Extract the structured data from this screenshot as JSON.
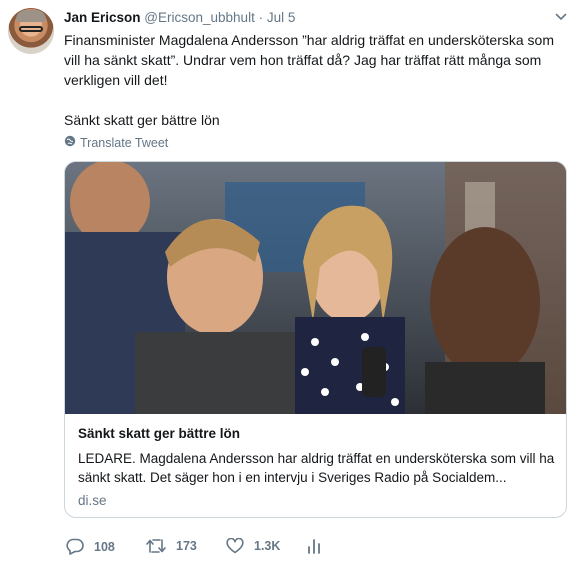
{
  "tweet": {
    "author_name": "Jan Ericson",
    "author_handle": "@Ericson_ubbhult",
    "separator": "·",
    "date": "Jul 5",
    "text_line1": "Finansminister Magdalena Andersson ”har aldrig träffat en undersköterska som vill ha sänkt skatt”.  Undrar vem hon träffat då? Jag har träffat rätt många som verkligen vill det!",
    "text_line2": "Sänkt skatt ger bättre lön",
    "translate_label": "Translate Tweet"
  },
  "card": {
    "title": "Sänkt skatt ger bättre lön",
    "description": "LEDARE. Magdalena Andersson har aldrig träffat en undersköterska som vill ha sänkt skatt. Det säger hon i en intervju i Sveriges Radio på Socialdem...",
    "domain": "di.se"
  },
  "actions": {
    "reply_count": "108",
    "retweet_count": "173",
    "like_count": "1.3K"
  },
  "icons": {
    "caret": "chevron-down-icon",
    "translate": "globe-icon",
    "reply": "reply-icon",
    "retweet": "retweet-icon",
    "like": "heart-icon",
    "analytics": "analytics-icon"
  },
  "colors": {
    "secondary_text": "#657786",
    "border": "#ccd6dd"
  }
}
